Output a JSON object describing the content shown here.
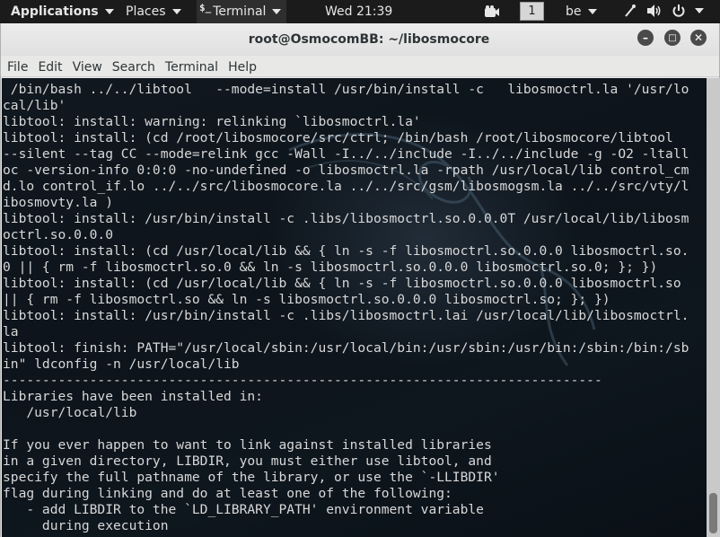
{
  "topbar": {
    "applications": "Applications",
    "places": "Places",
    "terminal_glyph": "$_",
    "terminal": "Terminal",
    "clock": "Wed 21:39",
    "workspace": "1",
    "keyboard_layout": "be"
  },
  "window": {
    "title": "root@OsmocomBB: ~/libosmocore",
    "minimize": "–",
    "maximize": "□",
    "close": "✕"
  },
  "menu": [
    "File",
    "Edit",
    "View",
    "Search",
    "Terminal",
    "Help"
  ],
  "terminal_lines": [
    " /bin/bash ../../libtool   --mode=install /usr/bin/install -c   libosmoctrl.la '/usr/lo",
    "cal/lib'",
    "libtool: install: warning: relinking `libosmoctrl.la'",
    "libtool: install: (cd /root/libosmocore/src/ctrl; /bin/bash /root/libosmocore/libtool",
    "--silent --tag CC --mode=relink gcc -Wall -I../../include -I../../include -g -O2 -ltall",
    "oc -version-info 0:0:0 -no-undefined -o libosmoctrl.la -rpath /usr/local/lib control_cm",
    "d.lo control_if.lo ../../src/libosmocore.la ../../src/gsm/libosmogsm.la ../../src/vty/l",
    "ibosmovty.la )",
    "libtool: install: /usr/bin/install -c .libs/libosmoctrl.so.0.0.0T /usr/local/lib/libosm",
    "octrl.so.0.0.0",
    "libtool: install: (cd /usr/local/lib && { ln -s -f libosmoctrl.so.0.0.0 libosmoctrl.so.",
    "0 || { rm -f libosmoctrl.so.0 && ln -s libosmoctrl.so.0.0.0 libosmoctrl.so.0; }; })",
    "libtool: install: (cd /usr/local/lib && { ln -s -f libosmoctrl.so.0.0.0 libosmoctrl.so",
    "|| { rm -f libosmoctrl.so && ln -s libosmoctrl.so.0.0.0 libosmoctrl.so; }; })",
    "libtool: install: /usr/bin/install -c .libs/libosmoctrl.lai /usr/local/lib/libosmoctrl.",
    "la",
    "libtool: finish: PATH=\"/usr/local/sbin:/usr/local/bin:/usr/sbin:/usr/bin:/sbin:/bin:/sb",
    "in\" ldconfig -n /usr/local/lib",
    "----------------------------------------------------------------------------",
    "Libraries have been installed in:",
    "   /usr/local/lib",
    "",
    "If you ever happen to want to link against installed libraries",
    "in a given directory, LIBDIR, you must either use libtool, and",
    "specify the full pathname of the library, or use the `-LLIBDIR'",
    "flag during linking and do at least one of the following:",
    "   - add LIBDIR to the `LD_LIBRARY_PATH' environment variable",
    "     during execution"
  ],
  "colors": {
    "topbar_bg": "#1b1b1b",
    "terminal_bg": "#0d141b",
    "terminal_fg": "#d8d8d8",
    "window_chrome": "#e8e8e7"
  },
  "icons": [
    "terminal-icon",
    "camera-icon",
    "accessibility-icon",
    "volume-icon",
    "power-icon"
  ]
}
